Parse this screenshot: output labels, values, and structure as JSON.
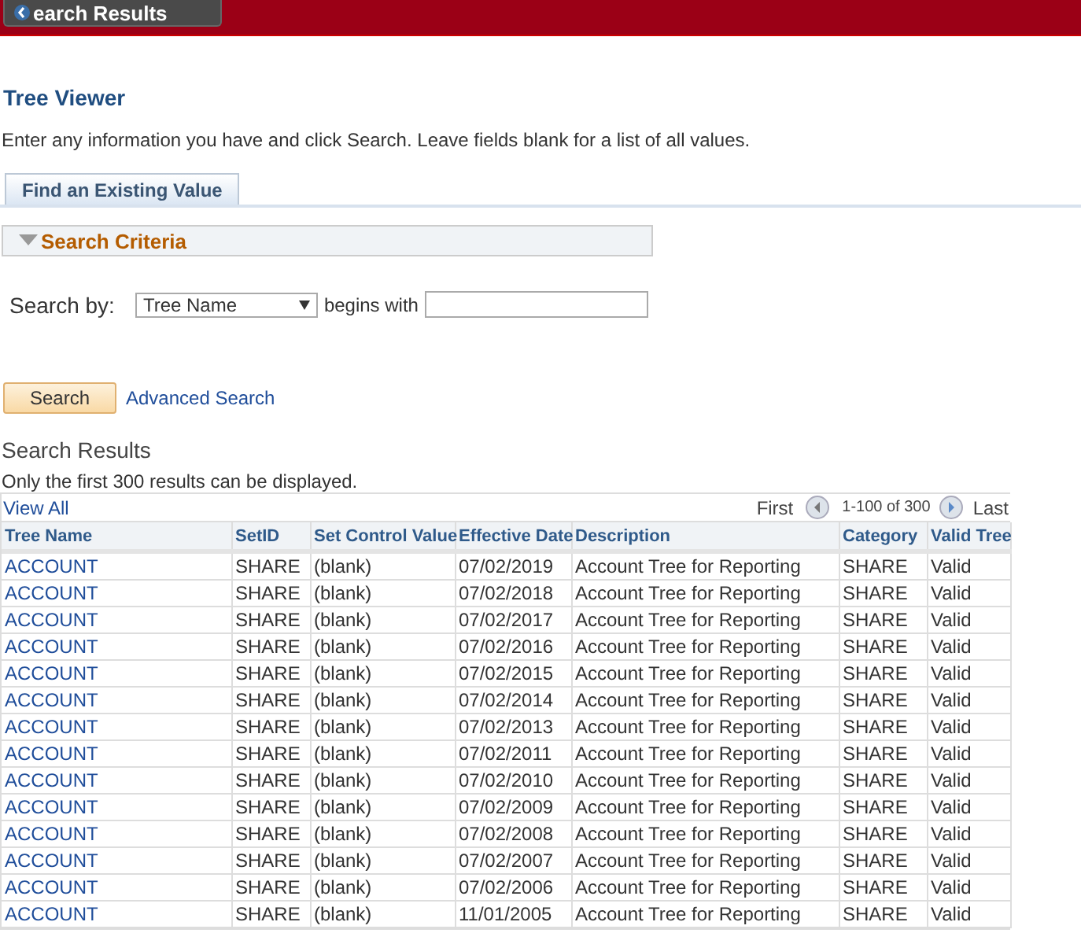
{
  "back_button": {
    "label": "earch Results"
  },
  "page_title": "Tree Viewer",
  "instructions": "Enter any information you have and click Search. Leave fields blank for a list of all values.",
  "tabs": [
    {
      "label": "Find an Existing Value",
      "selected": true
    }
  ],
  "search_criteria": {
    "title": "Search Criteria",
    "expanded": true,
    "search_by_label": "Search by:",
    "search_by_value": "Tree Name",
    "operator": "begins with"
  },
  "search_button": "Search",
  "advanced_search_link": "Advanced Search",
  "results": {
    "title": "Search Results",
    "note": "Only the first 300 results can be displayed.",
    "view_all": "View All",
    "first": "First",
    "range": "1-100 of 300",
    "last": "Last",
    "columns": [
      "Tree Name",
      "SetID",
      "Set Control Value",
      "Effective Date",
      "Description",
      "Category",
      "Valid Tree"
    ],
    "rows": [
      [
        "ACCOUNT",
        "SHARE",
        "(blank)",
        "07/02/2019",
        "Account Tree for Reporting",
        "SHARE",
        "Valid"
      ],
      [
        "ACCOUNT",
        "SHARE",
        "(blank)",
        "07/02/2018",
        "Account Tree for Reporting",
        "SHARE",
        "Valid"
      ],
      [
        "ACCOUNT",
        "SHARE",
        "(blank)",
        "07/02/2017",
        "Account Tree for Reporting",
        "SHARE",
        "Valid"
      ],
      [
        "ACCOUNT",
        "SHARE",
        "(blank)",
        "07/02/2016",
        "Account Tree for Reporting",
        "SHARE",
        "Valid"
      ],
      [
        "ACCOUNT",
        "SHARE",
        "(blank)",
        "07/02/2015",
        "Account Tree for Reporting",
        "SHARE",
        "Valid"
      ],
      [
        "ACCOUNT",
        "SHARE",
        "(blank)",
        "07/02/2014",
        "Account Tree for Reporting",
        "SHARE",
        "Valid"
      ],
      [
        "ACCOUNT",
        "SHARE",
        "(blank)",
        "07/02/2013",
        "Account Tree for Reporting",
        "SHARE",
        "Valid"
      ],
      [
        "ACCOUNT",
        "SHARE",
        "(blank)",
        "07/02/2011",
        "Account Tree for Reporting",
        "SHARE",
        "Valid"
      ],
      [
        "ACCOUNT",
        "SHARE",
        "(blank)",
        "07/02/2010",
        "Account Tree for Reporting",
        "SHARE",
        "Valid"
      ],
      [
        "ACCOUNT",
        "SHARE",
        "(blank)",
        "07/02/2009",
        "Account Tree for Reporting",
        "SHARE",
        "Valid"
      ],
      [
        "ACCOUNT",
        "SHARE",
        "(blank)",
        "07/02/2008",
        "Account Tree for Reporting",
        "SHARE",
        "Valid"
      ],
      [
        "ACCOUNT",
        "SHARE",
        "(blank)",
        "07/02/2007",
        "Account Tree for Reporting",
        "SHARE",
        "Valid"
      ],
      [
        "ACCOUNT",
        "SHARE",
        "(blank)",
        "07/02/2006",
        "Account Tree for Reporting",
        "SHARE",
        "Valid"
      ],
      [
        "ACCOUNT",
        "SHARE",
        "(blank)",
        "11/01/2005",
        "Account Tree for Reporting",
        "SHARE",
        "Valid"
      ]
    ]
  }
}
